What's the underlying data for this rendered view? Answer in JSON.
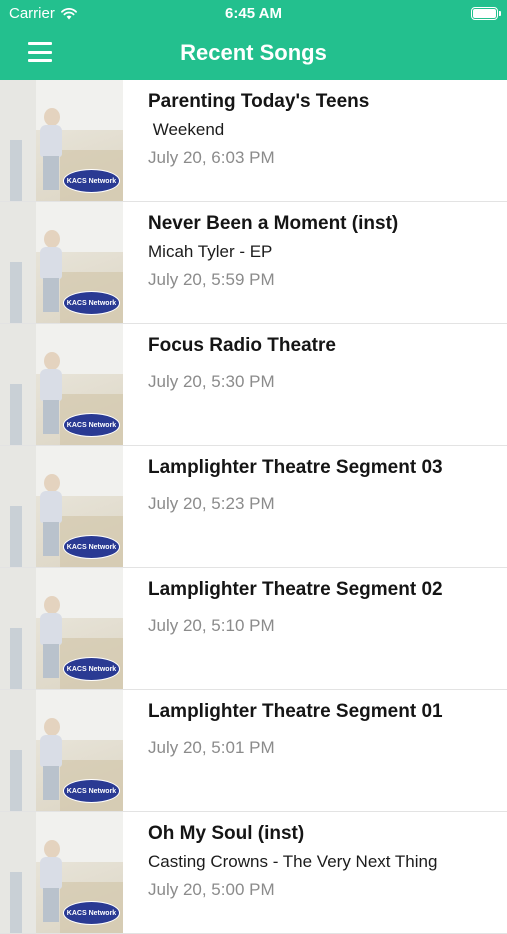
{
  "status_bar": {
    "carrier": "Carrier",
    "time": "6:45 AM",
    "wifi_icon": "wifi-icon",
    "battery_icon": "battery-icon"
  },
  "nav": {
    "title": "Recent Songs",
    "menu_icon": "hamburger-menu-icon"
  },
  "colors": {
    "header_bg": "#23c08e",
    "time_text": "#8b8b8b",
    "logo_badge": "#2a3a93"
  },
  "artwork": {
    "badge_text": "KACS Network"
  },
  "songs": [
    {
      "title": "Parenting Today's Teens",
      "artist": " Weekend",
      "time": "July 20, 6:03 PM"
    },
    {
      "title": "Never Been a Moment (inst)",
      "artist": "Micah Tyler - EP",
      "time": "July 20, 5:59 PM"
    },
    {
      "title": "Focus Radio Theatre",
      "artist": "",
      "time": "July 20, 5:30 PM"
    },
    {
      "title": "Lamplighter Theatre Segment 03",
      "artist": "",
      "time": "July 20, 5:23 PM"
    },
    {
      "title": "Lamplighter Theatre Segment 02",
      "artist": "",
      "time": "July 20, 5:10 PM"
    },
    {
      "title": "Lamplighter Theatre Segment 01",
      "artist": "",
      "time": "July 20, 5:01 PM"
    },
    {
      "title": "Oh My Soul (inst)",
      "artist": "Casting Crowns - The Very Next Thing",
      "time": "July 20, 5:00 PM"
    }
  ]
}
